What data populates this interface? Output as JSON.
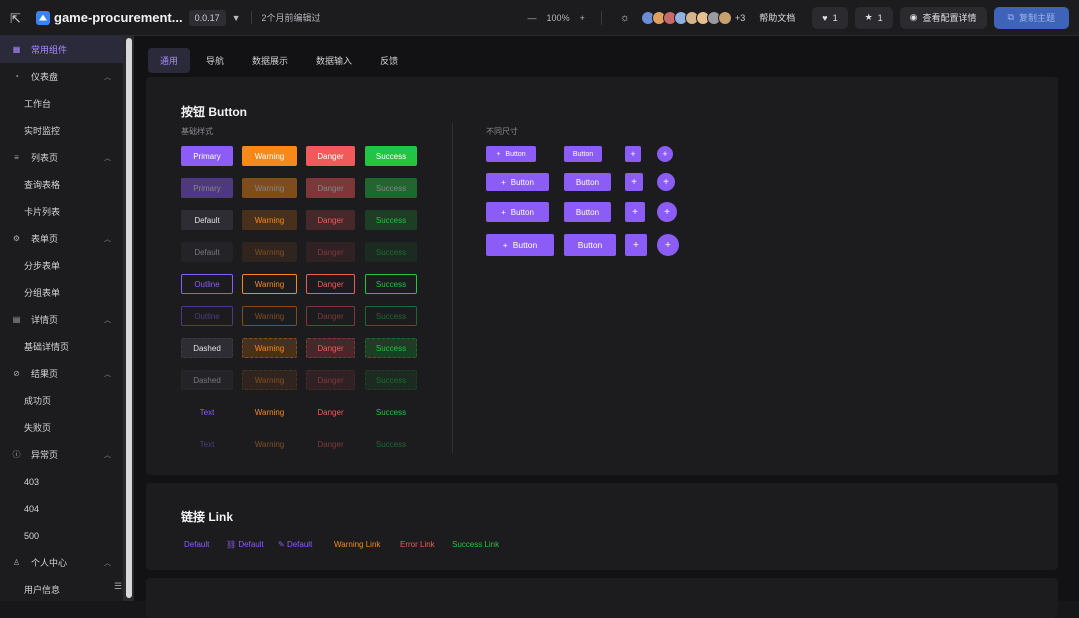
{
  "topbar": {
    "app_name": "game-procurement...",
    "version": "0.0.17",
    "edited": "2个月前编辑过",
    "zoom_minus": "—",
    "zoom_level": "100%",
    "zoom_plus": "+",
    "avatar_colors": [
      "#6b8cd6",
      "#e0a060",
      "#c86a6a",
      "#8fb0e0",
      "#d4b48a",
      "#e8c090",
      "#9a9aa0",
      "#c8a070"
    ],
    "avatars_more": "+3",
    "help": "帮助文档",
    "like_count": "1",
    "star_count": "1",
    "view_config": "查看配置详情",
    "copy_theme": "复制主题"
  },
  "sidebar": {
    "items": [
      {
        "label": "常用组件",
        "icon": "grid-icon",
        "level": 0,
        "active": true
      },
      {
        "label": "仪表盘",
        "icon": "dashboard-icon",
        "level": 0,
        "expanded": true
      },
      {
        "label": "工作台",
        "level": 1
      },
      {
        "label": "实时监控",
        "level": 1
      },
      {
        "label": "列表页",
        "icon": "list-icon",
        "level": 0,
        "expanded": true
      },
      {
        "label": "查询表格",
        "level": 1
      },
      {
        "label": "卡片列表",
        "level": 1
      },
      {
        "label": "表单页",
        "icon": "settings-icon",
        "level": 0,
        "expanded": true
      },
      {
        "label": "分步表单",
        "level": 1
      },
      {
        "label": "分组表单",
        "level": 1
      },
      {
        "label": "详情页",
        "icon": "file-icon",
        "level": 0,
        "expanded": true
      },
      {
        "label": "基础详情页",
        "level": 1
      },
      {
        "label": "结果页",
        "icon": "check-circle-icon",
        "level": 0,
        "expanded": true
      },
      {
        "label": "成功页",
        "level": 1
      },
      {
        "label": "失败页",
        "level": 1
      },
      {
        "label": "异常页",
        "icon": "warning-circle-icon",
        "level": 0,
        "expanded": true
      },
      {
        "label": "403",
        "level": 1
      },
      {
        "label": "404",
        "level": 1
      },
      {
        "label": "500",
        "level": 1
      },
      {
        "label": "个人中心",
        "icon": "user-icon",
        "level": 0,
        "expanded": true
      },
      {
        "label": "用户信息",
        "level": 1
      }
    ]
  },
  "tabs": [
    {
      "label": "通用",
      "active": true
    },
    {
      "label": "导航"
    },
    {
      "label": "数据展示"
    },
    {
      "label": "数据输入"
    },
    {
      "label": "反馈"
    }
  ],
  "button_card": {
    "title": "按钮 Button",
    "basic_label": "基础样式",
    "size_label": "不同尺寸",
    "rows": [
      [
        "Primary",
        "Warning",
        "Danger",
        "Success"
      ],
      [
        "Primary",
        "Warning",
        "Danger",
        "Success"
      ],
      [
        "Default",
        "Warning",
        "Danger",
        "Success"
      ],
      [
        "Default",
        "Warning",
        "Danger",
        "Success"
      ],
      [
        "Outline",
        "Warning",
        "Danger",
        "Success"
      ],
      [
        "Outline",
        "Warning",
        "Danger",
        "Success"
      ],
      [
        "Dashed",
        "Warning",
        "Danger",
        "Success"
      ],
      [
        "Dashed",
        "Warning",
        "Danger",
        "Success"
      ],
      [
        "Text",
        "Warning",
        "Danger",
        "Success"
      ],
      [
        "Text",
        "Warning",
        "Danger",
        "Success"
      ]
    ],
    "size_button_label": "Button"
  },
  "link_card": {
    "title": "链接 Link",
    "links": [
      "Default",
      "Default",
      "Default",
      "Warning Link",
      "Error Link",
      "Success Link"
    ]
  },
  "colors": {
    "primary": "#8b5cf6",
    "warning": "#f7881a",
    "danger": "#f05a5a",
    "success": "#23c343",
    "active_text": "#a98bff"
  }
}
